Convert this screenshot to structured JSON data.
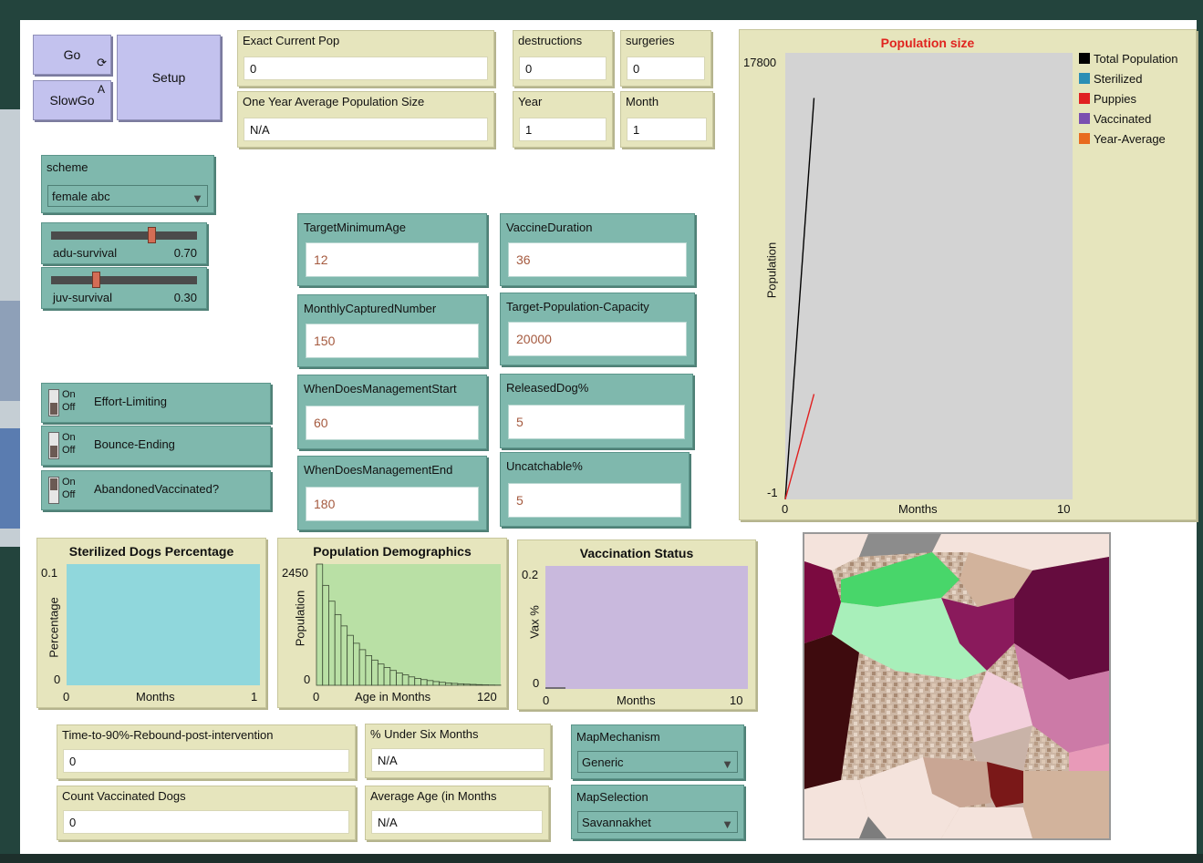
{
  "buttons": {
    "go": "Go",
    "go_marker": "⟳",
    "slowgo": "SlowGo",
    "slowgo_key": "A",
    "setup": "Setup"
  },
  "monitors": {
    "exact_current_pop": {
      "label": "Exact Current Pop",
      "value": "0"
    },
    "one_year_avg": {
      "label": "One Year Average Population Size",
      "value": "N/A"
    },
    "destructions": {
      "label": "destructions",
      "value": "0"
    },
    "surgeries": {
      "label": "surgeries",
      "value": "0"
    },
    "year": {
      "label": "Year",
      "value": "1"
    },
    "month": {
      "label": "Month",
      "value": "1"
    },
    "time_to_rebound": {
      "label": "Time-to-90%-Rebound-post-intervention",
      "value": "0"
    },
    "under_six_months": {
      "label": "% Under Six Months",
      "value": "N/A"
    },
    "count_vaccinated": {
      "label": "Count Vaccinated Dogs",
      "value": "0"
    },
    "average_age": {
      "label": "Average Age (in Months",
      "value": "N/A"
    }
  },
  "scheme": {
    "label": "scheme",
    "value": "female abc"
  },
  "sliders": {
    "adu_survival": {
      "label": "adu-survival",
      "value": "0.70",
      "fraction": 0.7
    },
    "juv_survival": {
      "label": "juv-survival",
      "value": "0.30",
      "fraction": 0.3
    }
  },
  "switches": {
    "effort_limiting": {
      "label": "Effort-Limiting",
      "on": "On",
      "off": "Off",
      "state": "off"
    },
    "bounce_ending": {
      "label": "Bounce-Ending",
      "on": "On",
      "off": "Off",
      "state": "off"
    },
    "abandoned_vaccinated": {
      "label": "AbandonedVaccinated?",
      "on": "On",
      "off": "Off",
      "state": "on"
    }
  },
  "inputs": {
    "target_min_age": {
      "label": "TargetMinimumAge",
      "value": "12"
    },
    "vaccine_duration": {
      "label": "VaccineDuration",
      "value": "36"
    },
    "monthly_captured": {
      "label": "MonthlyCapturedNumber",
      "value": "150"
    },
    "target_capacity": {
      "label": "Target-Population-Capacity",
      "value": "20000"
    },
    "mgmt_start": {
      "label": "WhenDoesManagementStart",
      "value": "60"
    },
    "released_dog": {
      "label": "ReleasedDog%",
      "value": "5"
    },
    "mgmt_end": {
      "label": "WhenDoesManagementEnd",
      "value": "180"
    },
    "uncatchable": {
      "label": "Uncatchable%",
      "value": "5"
    }
  },
  "map_mechanism": {
    "label": "MapMechanism",
    "value": "Generic"
  },
  "map_selection": {
    "label": "MapSelection",
    "value": "Savannakhet"
  },
  "colors": {
    "title_red": "#e0241f",
    "plot_bg": "#d3d3d3",
    "tan": "#e6e5bd",
    "teal": "#7fb8ad",
    "button": "#c3c2ee"
  },
  "chart_data": [
    {
      "type": "line",
      "title": "Population size",
      "xlabel": "Months",
      "ylabel": "Population",
      "xlim": [
        0,
        10
      ],
      "ylim": [
        -1,
        17800
      ],
      "tick_labels": {
        "x_min": "0",
        "x_max": "10",
        "y_min": "-1",
        "y_max": "17800"
      },
      "legend_position": "right",
      "series": [
        {
          "name": "Total Population",
          "color": "#000000",
          "x": [
            0,
            1
          ],
          "y": [
            0,
            16000
          ]
        },
        {
          "name": "Sterilized",
          "color": "#2b8fb5",
          "x": [],
          "y": []
        },
        {
          "name": "Puppies",
          "color": "#e02020",
          "x": [
            0,
            1
          ],
          "y": [
            0,
            4200
          ]
        },
        {
          "name": "Vaccinated",
          "color": "#7a4fb0",
          "x": [],
          "y": []
        },
        {
          "name": "Year-Average",
          "color": "#e86a1e",
          "x": [],
          "y": []
        }
      ]
    },
    {
      "type": "area",
      "title": "Sterilized Dogs Percentage",
      "xlabel": "Months",
      "ylabel": "Percentage",
      "xlim": [
        0,
        1
      ],
      "ylim": [
        0,
        0.1
      ],
      "tick_labels": {
        "x_min": "0",
        "x_max": "1",
        "y_min": "0",
        "y_max": "0.1"
      },
      "fill": "#90d7dc"
    },
    {
      "type": "bar",
      "title": "Population Demographics",
      "xlabel": "Age in Months",
      "ylabel": "Population",
      "xlim": [
        0,
        120
      ],
      "ylim": [
        0,
        2450
      ],
      "tick_labels": {
        "x_min": "0",
        "x_max": "120",
        "y_min": "0",
        "y_max": "2450"
      },
      "bin_width": 4,
      "values": [
        2450,
        2020,
        1700,
        1430,
        1200,
        1010,
        850,
        720,
        600,
        510,
        430,
        360,
        300,
        250,
        210,
        170,
        140,
        115,
        95,
        75,
        60,
        48,
        38,
        30,
        23,
        18,
        13,
        9,
        6,
        4
      ]
    },
    {
      "type": "area",
      "title": "Vaccination Status",
      "xlabel": "Months",
      "ylabel": "Vax %",
      "xlim": [
        0,
        10
      ],
      "ylim": [
        0,
        0.2
      ],
      "tick_labels": {
        "x_min": "0",
        "x_max": "10",
        "y_min": "0",
        "y_max": "0.2"
      },
      "fill": "#c9b9dd"
    }
  ]
}
